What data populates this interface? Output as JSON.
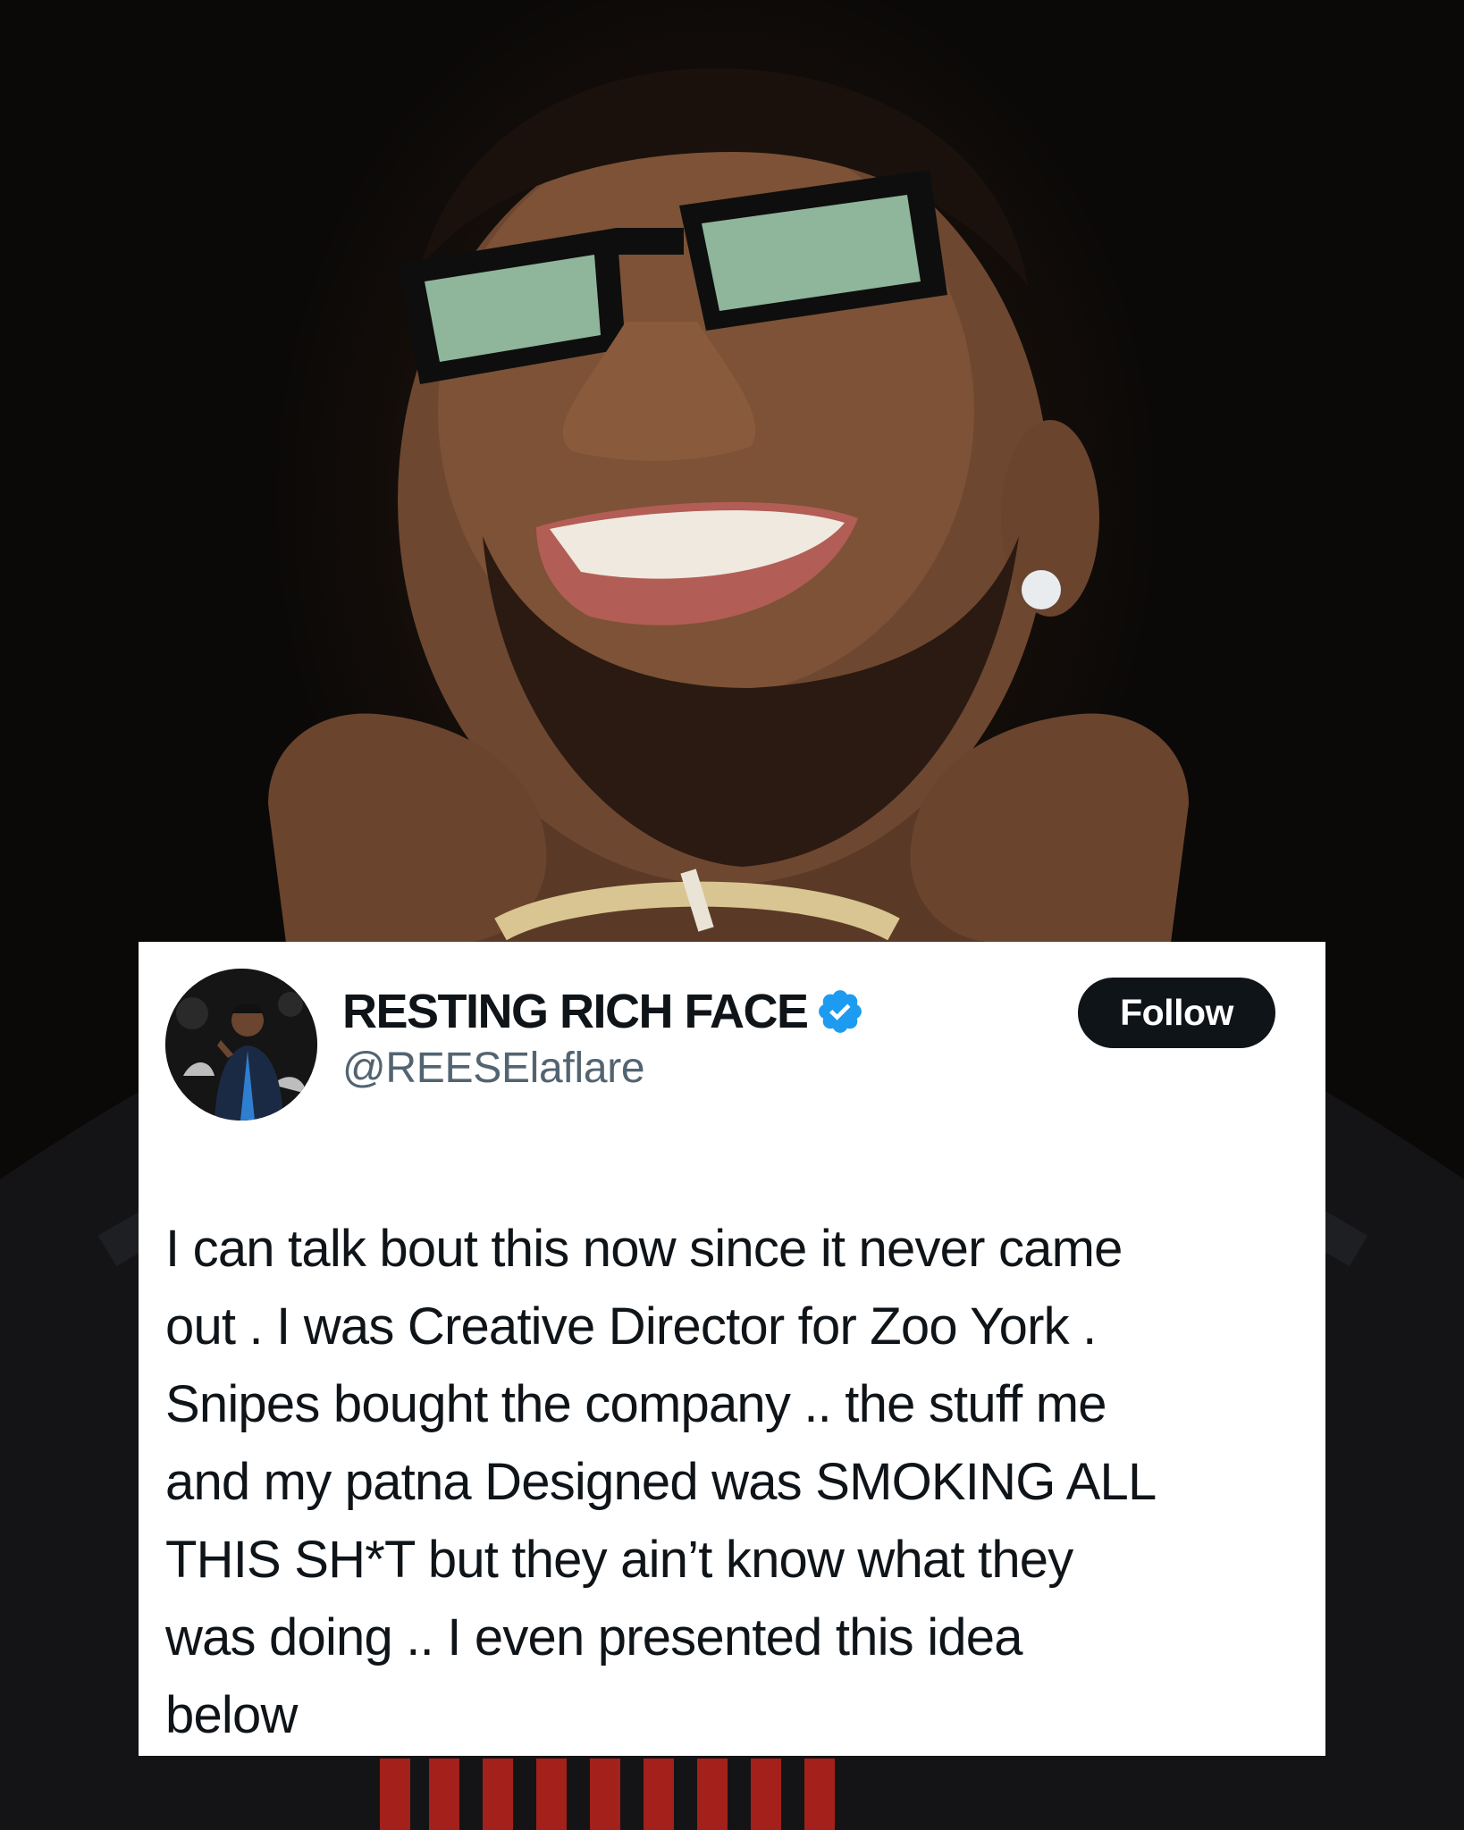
{
  "tweet": {
    "display_name": "RESTING RICH FACE",
    "handle": "@REESElaflare",
    "verified": true,
    "follow_label": "Follow",
    "text_lines": [
      "I can talk bout this now since it never came",
      "out . I was Creative Director for Zoo York .",
      "Snipes bought the company .. the stuff me",
      "and my patna Designed was SMOKING ALL",
      "THIS SH*T but they ain’t know what they",
      "was doing .. I even presented this idea",
      "below"
    ]
  },
  "colors": {
    "verified_badge": "#1d9bf0",
    "follow_button": "#0f1419",
    "handle_text": "#536471",
    "body_text": "#0f1419",
    "card_background": "#ffffff",
    "page_background": "#0b0908"
  },
  "icons": {
    "verified": "verified-badge-icon"
  }
}
